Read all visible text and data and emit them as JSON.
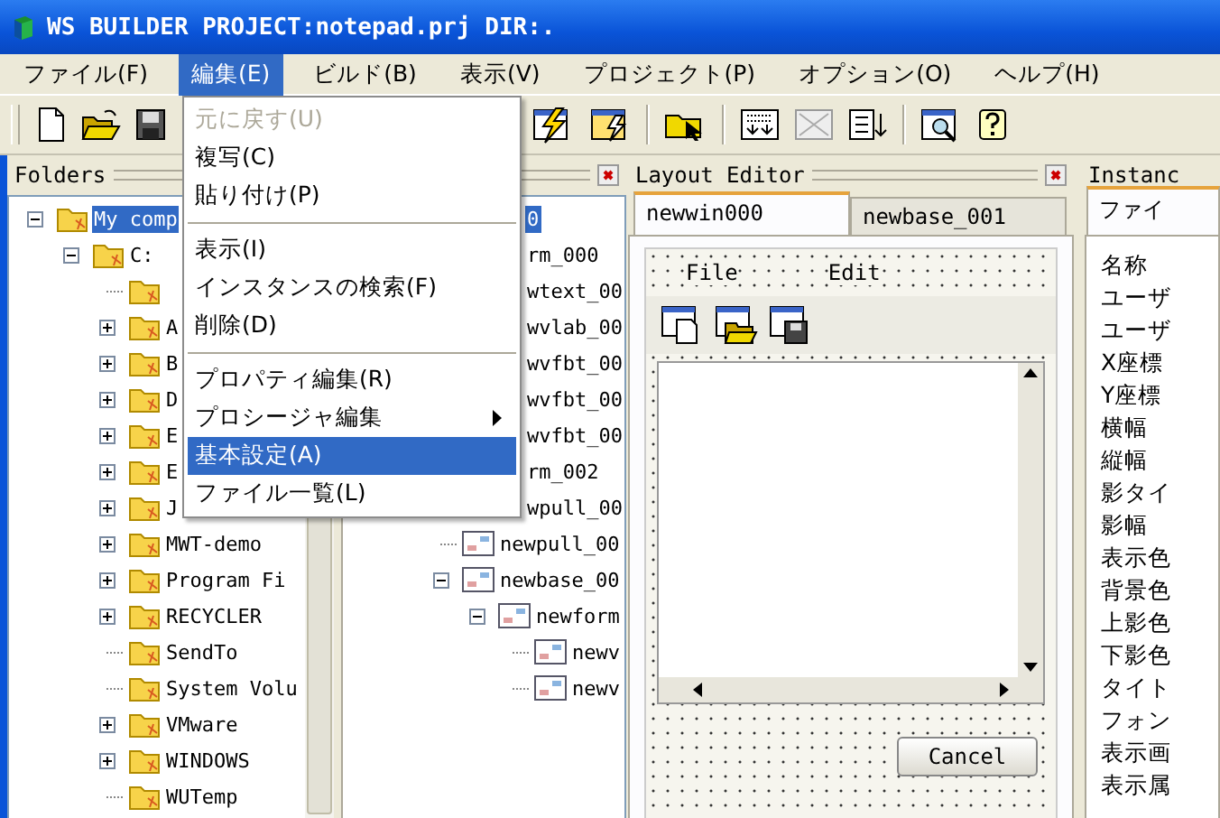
{
  "window": {
    "title": "WS BUILDER PROJECT:notepad.prj DIR:."
  },
  "menu_bar": [
    {
      "label": "ファイル(F)",
      "selected": false
    },
    {
      "label": "編集(E)",
      "selected": true
    },
    {
      "label": "ビルド(B)",
      "selected": false
    },
    {
      "label": "表示(V)",
      "selected": false
    },
    {
      "label": "プロジェクト(P)",
      "selected": false
    },
    {
      "label": "オプション(O)",
      "selected": false
    },
    {
      "label": "ヘルプ(H)",
      "selected": false
    }
  ],
  "edit_menu": [
    {
      "kind": "item",
      "label": "元に戻す(U)",
      "disabled": true,
      "selected": false
    },
    {
      "kind": "item",
      "label": "複写(C)",
      "disabled": false,
      "selected": false
    },
    {
      "kind": "item",
      "label": "貼り付け(P)",
      "disabled": false,
      "selected": false
    },
    {
      "kind": "separator"
    },
    {
      "kind": "item",
      "label": "表示(I)",
      "disabled": false,
      "selected": false
    },
    {
      "kind": "item",
      "label": "インスタンスの検索(F)",
      "disabled": false,
      "selected": false
    },
    {
      "kind": "item",
      "label": "削除(D)",
      "disabled": false,
      "selected": false
    },
    {
      "kind": "separator"
    },
    {
      "kind": "item",
      "label": "プロパティ編集(R)",
      "disabled": false,
      "selected": false
    },
    {
      "kind": "submenu",
      "label": "プロシージャ編集",
      "disabled": false,
      "selected": false
    },
    {
      "kind": "item",
      "label": "基本設定(A)",
      "disabled": false,
      "selected": true
    },
    {
      "kind": "item",
      "label": "ファイル一覧(L)",
      "disabled": false,
      "selected": false
    }
  ],
  "folders_panel": {
    "title": "Folders",
    "folder_tree": [
      {
        "label": "My comp",
        "selected": true,
        "expanded": true,
        "children": [
          {
            "label": "C:",
            "selected": false,
            "expanded": true,
            "children": [
              {
                "selected": false
              },
              {
                "label": "A",
                "selected": false,
                "expanded": false
              },
              {
                "label": "B",
                "selected": false,
                "expanded": false
              },
              {
                "label": "D",
                "selected": false,
                "expanded": false
              },
              {
                "label": "E",
                "selected": false,
                "expanded": false
              },
              {
                "label": "E",
                "selected": false,
                "expanded": false
              },
              {
                "label": "J",
                "selected": false,
                "expanded": false
              },
              {
                "label": "MWT-demo",
                "selected": false,
                "expanded": false
              },
              {
                "label": "Program Fi",
                "selected": false,
                "expanded": false
              },
              {
                "label": "RECYCLER",
                "selected": false,
                "expanded": false
              },
              {
                "label": "SendTo",
                "selected": false
              },
              {
                "label": "System Volu",
                "selected": false
              },
              {
                "label": "VMware",
                "selected": false,
                "expanded": false
              },
              {
                "label": "WINDOWS",
                "selected": false,
                "expanded": false
              },
              {
                "label": "WUTemp",
                "selected": false
              }
            ]
          }
        ]
      }
    ],
    "instance_tree": [
      {
        "kind": "cut",
        "label": "0",
        "selected": true,
        "children": [
          {
            "kind": "cut",
            "label": "rm_000",
            "selected": false
          },
          {
            "kind": "cut",
            "label": "wtext_00",
            "selected": false
          },
          {
            "kind": "cut",
            "label": "wvlab_00",
            "selected": false
          },
          {
            "kind": "cut",
            "label": "wvfbt_00",
            "selected": false
          },
          {
            "kind": "cut",
            "label": "wvfbt_00",
            "selected": false
          },
          {
            "kind": "cut",
            "label": "wvfbt_00",
            "selected": false
          },
          {
            "kind": "cut",
            "label": "rm_002",
            "selected": false
          },
          {
            "kind": "cut",
            "label": "wpull_00",
            "selected": false
          },
          {
            "kind": "node",
            "label": "newpull_00",
            "selected": false
          },
          {
            "kind": "node",
            "label": "newbase_00",
            "selected": false,
            "expanded": true,
            "children": [
              {
                "kind": "node",
                "label": "newform",
                "selected": false,
                "expanded": true,
                "children": [
                  {
                    "kind": "node",
                    "label": "newv",
                    "selected": false
                  },
                  {
                    "kind": "node",
                    "label": "newv",
                    "selected": false
                  }
                ]
              }
            ]
          }
        ]
      }
    ]
  },
  "layout_editor": {
    "title": "Layout Editor",
    "tabs": [
      {
        "label": "newwin000",
        "selected": true
      },
      {
        "label": "newbase_001",
        "selected": false
      }
    ],
    "form": {
      "menu": [
        "File",
        "Edit"
      ],
      "button": "Cancel"
    }
  },
  "instance_panel": {
    "title": "Instanc",
    "tabs": [
      {
        "label": "ファイ",
        "selected": true
      }
    ],
    "properties": [
      "名称",
      "ユーザ",
      "ユーザ",
      "X座標",
      "Y座標",
      "横幅",
      "縦幅",
      "影タイ",
      "影幅",
      "表示色",
      "背景色",
      "上影色",
      "下影色",
      "タイト",
      "フォン",
      "表示画",
      "表示属"
    ]
  }
}
